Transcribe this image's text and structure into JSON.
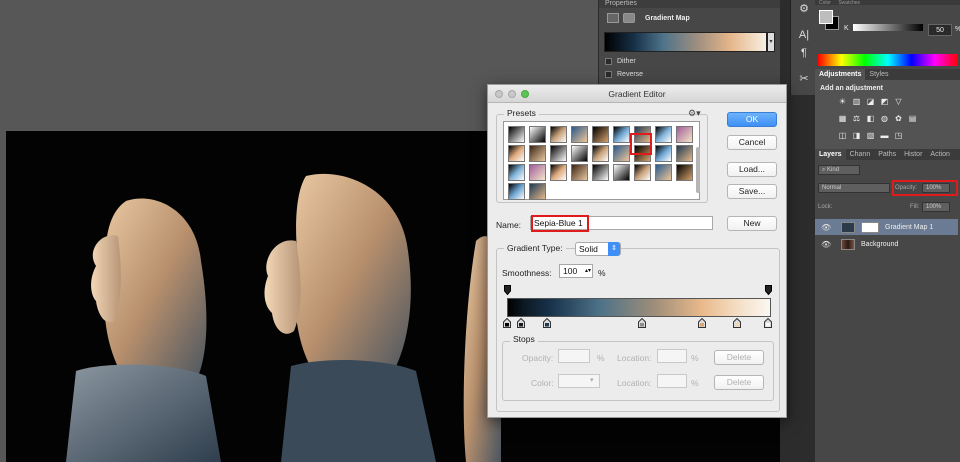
{
  "properties_panel": {
    "header": "Properties",
    "title": "Gradient Map",
    "dither_label": "Dither",
    "reverse_label": "Reverse"
  },
  "color_panel": {
    "tabs": [
      "Color",
      "Swatches"
    ],
    "channel_label": "K",
    "channel_value": "50",
    "percent": "%"
  },
  "adjustments_panel": {
    "tabs": [
      "Adjustments",
      "Styles"
    ],
    "title": "Add an adjustment"
  },
  "layers_panel": {
    "tabs": [
      "Layers",
      "Chann",
      "Paths",
      "Histor",
      "Action"
    ],
    "kind_label": "Kind",
    "blend_mode": "Normal",
    "opacity_label": "Opacity:",
    "opacity_value": "100%",
    "lock_label": "Lock:",
    "fill_label": "Fill:",
    "fill_value": "100%",
    "layers": [
      {
        "name": "Gradient Map 1"
      },
      {
        "name": "Background"
      }
    ]
  },
  "dialog": {
    "title": "Gradient Editor",
    "presets_label": "Presets",
    "buttons": {
      "ok": "OK",
      "cancel": "Cancel",
      "load": "Load...",
      "save": "Save...",
      "new": "New"
    },
    "name_label": "Name:",
    "name_value": "Sepia-Blue 1",
    "gradient_type_label": "Gradient Type:",
    "gradient_type_value": "Solid",
    "smoothness_label": "Smoothness:",
    "smoothness_value": "100",
    "percent": "%",
    "stops_label": "Stops",
    "stops_opacity_label": "Opacity:",
    "stops_location_label": "Location:",
    "stops_color_label": "Color:",
    "delete_label": "Delete"
  },
  "colors": {
    "accent_red": "#e01b1b",
    "ok_blue": "#3f8ff6"
  }
}
